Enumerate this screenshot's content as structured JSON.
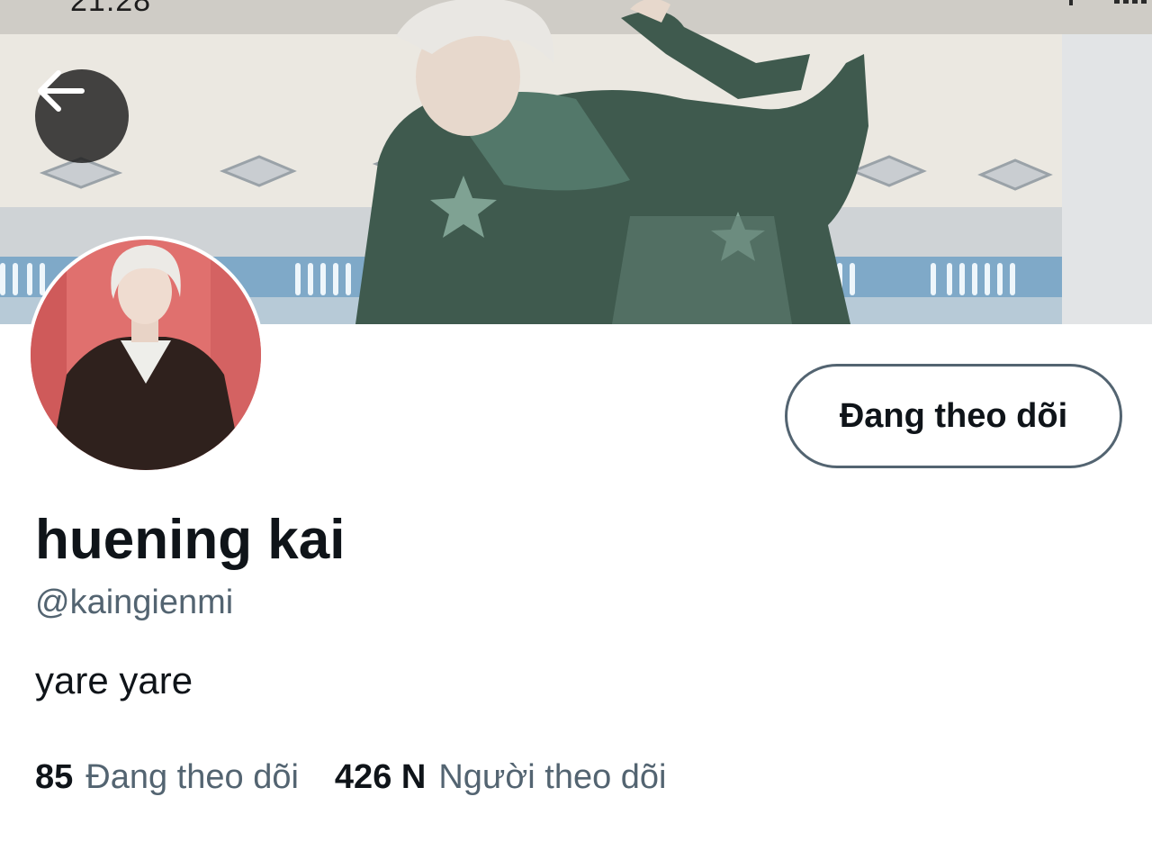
{
  "status_bar": {
    "time": "21:28"
  },
  "header": {
    "back_icon": "arrow-left-icon"
  },
  "profile": {
    "display_name": "huening kai",
    "handle": "@kaingienmi",
    "bio": "yare yare",
    "follow_button_label": "Đang theo dõi",
    "stats": {
      "following_count": "85",
      "following_label": "Đang theo dõi",
      "followers_count": "426 N",
      "followers_label": "Người theo dõi"
    }
  },
  "colors": {
    "text_primary": "#0f1419",
    "text_secondary": "#536471",
    "button_border": "#536471",
    "back_button_bg": "#1c1c1c"
  }
}
